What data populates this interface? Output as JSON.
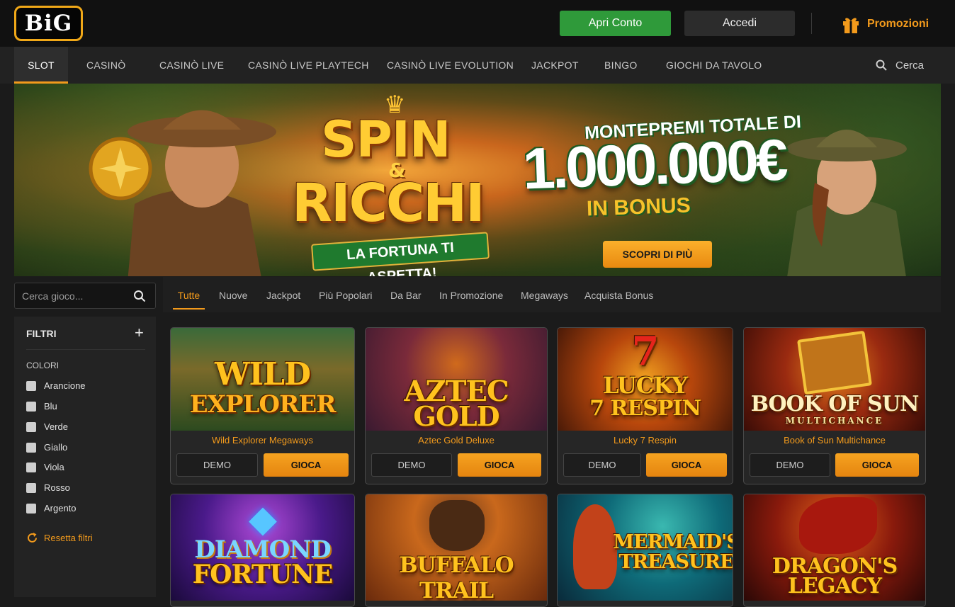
{
  "header": {
    "logo_text": "BiG",
    "open_account_label": "Apri Conto",
    "login_label": "Accedi",
    "promotions_label": "Promozioni",
    "promotions_icon": "gift-icon",
    "accent_color": "#f29a1c",
    "open_account_color": "#2f9a3a"
  },
  "nav": {
    "items": [
      {
        "label": "SLOT",
        "active": true
      },
      {
        "label": "CASINÒ"
      },
      {
        "label": "CASINÒ LIVE"
      },
      {
        "label": "CASINÒ LIVE PLAYTECH"
      },
      {
        "label": "CASINÒ LIVE EVOLUTION"
      },
      {
        "label": "JACKPOT"
      },
      {
        "label": "BINGO"
      },
      {
        "label": "GIOCHI DA TAVOLO"
      }
    ],
    "search_label": "Cerca",
    "search_icon": "search-icon"
  },
  "banner": {
    "title_line1": "SPIN",
    "title_amp": "&",
    "title_line2": "RICCHI",
    "ribbon": "LA FORTUNA TI ASPETTA!",
    "prize_intro": "MONTEPREMI TOTALE DI",
    "prize_amount": "1.000.000€",
    "prize_suffix": "IN BONUS",
    "cta_label": "SCOPRI DI PIÙ"
  },
  "sidebar": {
    "search_placeholder": "Cerca gioco...",
    "filters_title": "FILTRI",
    "filters_expand": "+",
    "colors_heading": "COLORI",
    "colors": [
      "Arancione",
      "Blu",
      "Verde",
      "Giallo",
      "Viola",
      "Rosso",
      "Argento"
    ],
    "reset_label": "Resetta filtri"
  },
  "tabs": {
    "items": [
      {
        "label": "Tutte",
        "active": true
      },
      {
        "label": "Nuove"
      },
      {
        "label": "Jackpot"
      },
      {
        "label": "Più Popolari"
      },
      {
        "label": "Da Bar"
      },
      {
        "label": "In Promozione"
      },
      {
        "label": "Megaways"
      },
      {
        "label": "Acquista Bonus"
      }
    ]
  },
  "games": [
    {
      "art_line1": "WILD",
      "art_line2": "EXPLORER",
      "name": "Wild Explorer Megaways",
      "demo": "DEMO",
      "play": "GIOCA"
    },
    {
      "art_line1": "AZTEC",
      "art_line2": "GOLD",
      "name": "Aztec Gold Deluxe",
      "demo": "DEMO",
      "play": "GIOCA"
    },
    {
      "art_line1": "LUCKY",
      "art_line2": "7 RESPIN",
      "name": "Lucky 7 Respin",
      "demo": "DEMO",
      "play": "GIOCA"
    },
    {
      "art_line1": "BOOK OF SUN",
      "art_line2": "MULTICHANCE",
      "name": "Book of Sun Multichance",
      "demo": "DEMO",
      "play": "GIOCA"
    },
    {
      "art_line1": "DIAMOND",
      "art_line2": "FORTUNE"
    },
    {
      "art_line1": "BUFFALO TRAIL",
      "art_line2": ""
    },
    {
      "art_line1": "MERMAID'S",
      "art_line2": "TREASURE"
    },
    {
      "art_line1": "DRAGON'S",
      "art_line2": "LEGACY"
    }
  ]
}
